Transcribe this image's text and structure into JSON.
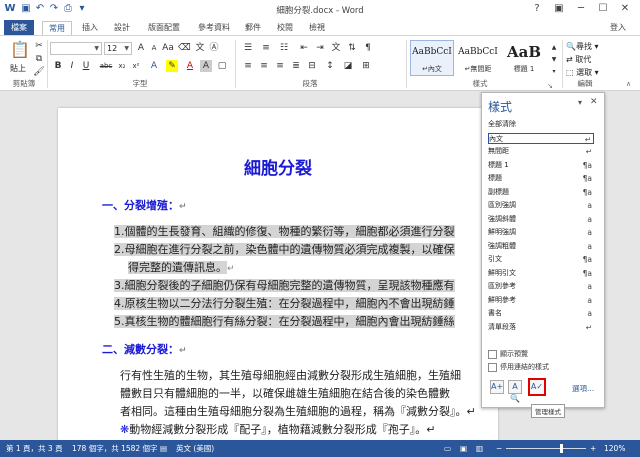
{
  "window": {
    "title": "細胞分裂.docx - Word"
  },
  "title_controls": {
    "help": "?",
    "ribbon_display": "▣",
    "minimize": "─",
    "maximize": "☐",
    "close": "✕"
  },
  "tabs": [
    "檔案",
    "常用",
    "插入",
    "設計",
    "版面配置",
    "參考資料",
    "郵件",
    "校閱",
    "檢視"
  ],
  "user": "登入",
  "ribbon": {
    "groups": {
      "clipboard": "剪貼簿",
      "font": "字型",
      "paragraph": "段落",
      "styles": "樣式",
      "editing": "編輯"
    },
    "paste_label": "貼上",
    "font_name": "",
    "font_size": "12",
    "font_buttons": [
      "B",
      "I",
      "U",
      "abc",
      "x₂",
      "x²",
      "A",
      "A"
    ],
    "style_cards": [
      {
        "sample": "AaBbCcI",
        "name": "↵內文"
      },
      {
        "sample": "AaBbCcI",
        "name": "↵無間距"
      },
      {
        "sample": "AaB",
        "name": "標題 1"
      }
    ],
    "editing": {
      "find": "尋找 ▾",
      "replace": "取代",
      "select": "選取 ▾"
    }
  },
  "document": {
    "title": "細胞分裂",
    "heading1": "一、分裂增殖：",
    "heading1_mark": "↵",
    "list": [
      "1.個體的生長發育、組織的修復、物種的繁衍等，細胞都必須進行分裂",
      "2.母細胞在進行分裂之前，染色體中的遺傳物質必須完成複製，以確保",
      "得完整的遺傳訊息。",
      "3.細胞分裂後的子細胞仍保有母細胞完整的遺傳物質，呈現該物種應有",
      "4.原核生物以二分法行分裂生殖：在分裂過程中，細胞內不會出現紡錘",
      "5.真核生物的體細胞行有絲分裂：在分裂過程中，細胞內會出現紡錘絲"
    ],
    "list_mark_short": "↵",
    "heading2": "二、減數分裂：",
    "heading2_mark": "↵",
    "para": [
      "行有性生殖的生物，其生殖母細胞經由減數分裂形成生殖細胞，生殖細",
      "體數目只有體細胞的一半，以確保雌雄生殖細胞在結合後的染色體數",
      "者相同。這種由生殖母細胞分裂為生殖細胞的過程，稱為『減數分裂』。↵",
      "動物經減數分裂形成『配子』，植物藉減數分裂形成『孢子』。↵"
    ],
    "bullet": "❋"
  },
  "styles_pane": {
    "title": "樣式",
    "menu_arrow": "▾",
    "close": "✕",
    "items": [
      {
        "name": "全部清除",
        "glyph": ""
      },
      {
        "name": "內文",
        "glyph": "↵"
      },
      {
        "name": "無間距",
        "glyph": "↵"
      },
      {
        "name": "標題 1",
        "glyph": "¶a"
      },
      {
        "name": "標題",
        "glyph": "¶a"
      },
      {
        "name": "副標題",
        "glyph": "¶a"
      },
      {
        "name": "區別強調",
        "glyph": "a"
      },
      {
        "name": "強調斜體",
        "glyph": "a"
      },
      {
        "name": "鮮明強調",
        "glyph": "a"
      },
      {
        "name": "強調粗體",
        "glyph": "a"
      },
      {
        "name": "引文",
        "glyph": "¶a"
      },
      {
        "name": "鮮明引文",
        "glyph": "¶a"
      },
      {
        "name": "區別參考",
        "glyph": "a"
      },
      {
        "name": "鮮明參考",
        "glyph": "a"
      },
      {
        "name": "書名",
        "glyph": "a"
      },
      {
        "name": "清單段落",
        "glyph": "↵"
      }
    ],
    "show_preview": "顯示預覽",
    "disable_linked": "停用連結的樣式",
    "options_link": "選項...",
    "manage_tooltip": "管理樣式"
  },
  "status": {
    "page": "第 1 頁，共 3 頁",
    "words": "178 個字，共 1582 個字",
    "lang": "英文 (美國)",
    "zoom": "120%",
    "zoom_minus": "−",
    "zoom_plus": "+"
  },
  "colors": {
    "accent": "#2b579a",
    "heading": "#1b1bd4",
    "highlight": "#d4d4d4",
    "callout": "#e00000"
  }
}
